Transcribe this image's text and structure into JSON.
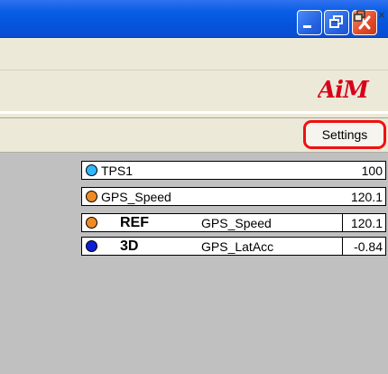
{
  "window": {
    "title_buttons": [
      "minimize-icon",
      "restore-icon",
      "close-icon"
    ]
  },
  "mdi_controls": {
    "minimize_glyph": "_",
    "restore_glyph": "🗗",
    "close_glyph": "×"
  },
  "logo": {
    "text": "AiM",
    "color": "#d8001a"
  },
  "settings": {
    "label": "Settings",
    "highlight_color": "#ee1111"
  },
  "channels": [
    {
      "name": "TPS1",
      "value": "100",
      "dot_color": "#2fb7ff"
    },
    {
      "name": "GPS_Speed",
      "value": "120.1",
      "dot_color": "#f08a24"
    }
  ],
  "compare_channels": [
    {
      "tag": "REF",
      "name": "GPS_Speed",
      "value": "120.1",
      "dot_color": "#f08a24"
    },
    {
      "tag": "3D",
      "name": "GPS_LatAcc",
      "value": "-0.84",
      "dot_color": "#0b1fd6"
    }
  ]
}
